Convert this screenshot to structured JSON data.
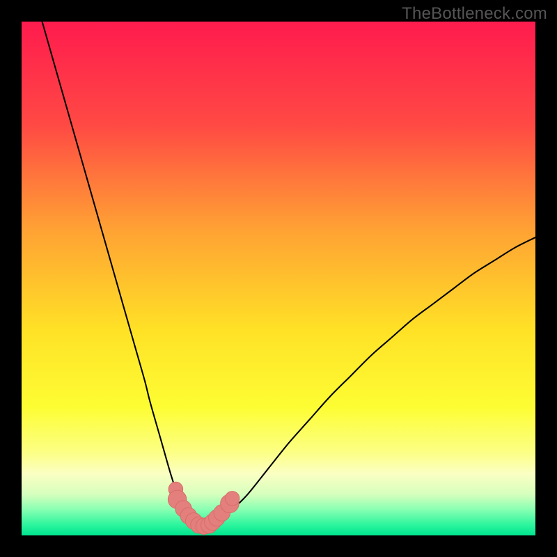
{
  "watermark": "TheBottleneck.com",
  "colors": {
    "frame": "#000000",
    "curve": "#000000",
    "marker_fill": "#e37f7d",
    "marker_stroke": "#d86a66"
  },
  "chart_data": {
    "type": "line",
    "title": "",
    "xlabel": "",
    "ylabel": "",
    "xlim": [
      0,
      100
    ],
    "ylim": [
      0,
      100
    ],
    "gradient_stops": [
      {
        "pos": 0.0,
        "color": "#ff1b4e"
      },
      {
        "pos": 0.2,
        "color": "#ff4944"
      },
      {
        "pos": 0.4,
        "color": "#ffa034"
      },
      {
        "pos": 0.6,
        "color": "#ffe126"
      },
      {
        "pos": 0.75,
        "color": "#fdfd33"
      },
      {
        "pos": 0.84,
        "color": "#fcff86"
      },
      {
        "pos": 0.88,
        "color": "#fbffc3"
      },
      {
        "pos": 0.92,
        "color": "#d6ffbd"
      },
      {
        "pos": 0.95,
        "color": "#87ffb2"
      },
      {
        "pos": 0.98,
        "color": "#2bf59d"
      },
      {
        "pos": 1.0,
        "color": "#00e48f"
      }
    ],
    "series": [
      {
        "name": "bottleneck-curve",
        "x": [
          4,
          6,
          8,
          10,
          12,
          14,
          16,
          18,
          20,
          22,
          24,
          25,
          27,
          29,
          30,
          31,
          32,
          33,
          34,
          35,
          36,
          37,
          39,
          41,
          44,
          48,
          52,
          56,
          60,
          64,
          68,
          72,
          76,
          80,
          84,
          88,
          92,
          96,
          100
        ],
        "y": [
          100,
          93,
          86,
          79,
          72,
          65,
          58,
          51,
          44,
          37,
          30,
          26,
          19,
          12,
          9,
          6.5,
          4.5,
          3,
          2,
          1.5,
          1.5,
          2,
          3,
          5,
          8,
          13,
          18,
          22.5,
          27,
          31,
          35,
          38.5,
          42,
          45,
          48,
          51,
          53.5,
          56,
          58
        ]
      }
    ],
    "markers": {
      "name": "highlight-points",
      "x": [
        30.0,
        30.3,
        31.5,
        32.5,
        33.5,
        34.5,
        35.5,
        36.5,
        37.2,
        38.0,
        39.0,
        40.5,
        41.0
      ],
      "y": [
        9.0,
        7.0,
        5.2,
        3.8,
        2.8,
        2.0,
        1.8,
        2.0,
        2.6,
        3.4,
        4.4,
        6.2,
        7.2
      ],
      "r": [
        1.4,
        1.8,
        1.6,
        1.6,
        1.6,
        1.6,
        1.6,
        1.6,
        1.6,
        1.6,
        1.6,
        1.8,
        1.4
      ]
    }
  }
}
